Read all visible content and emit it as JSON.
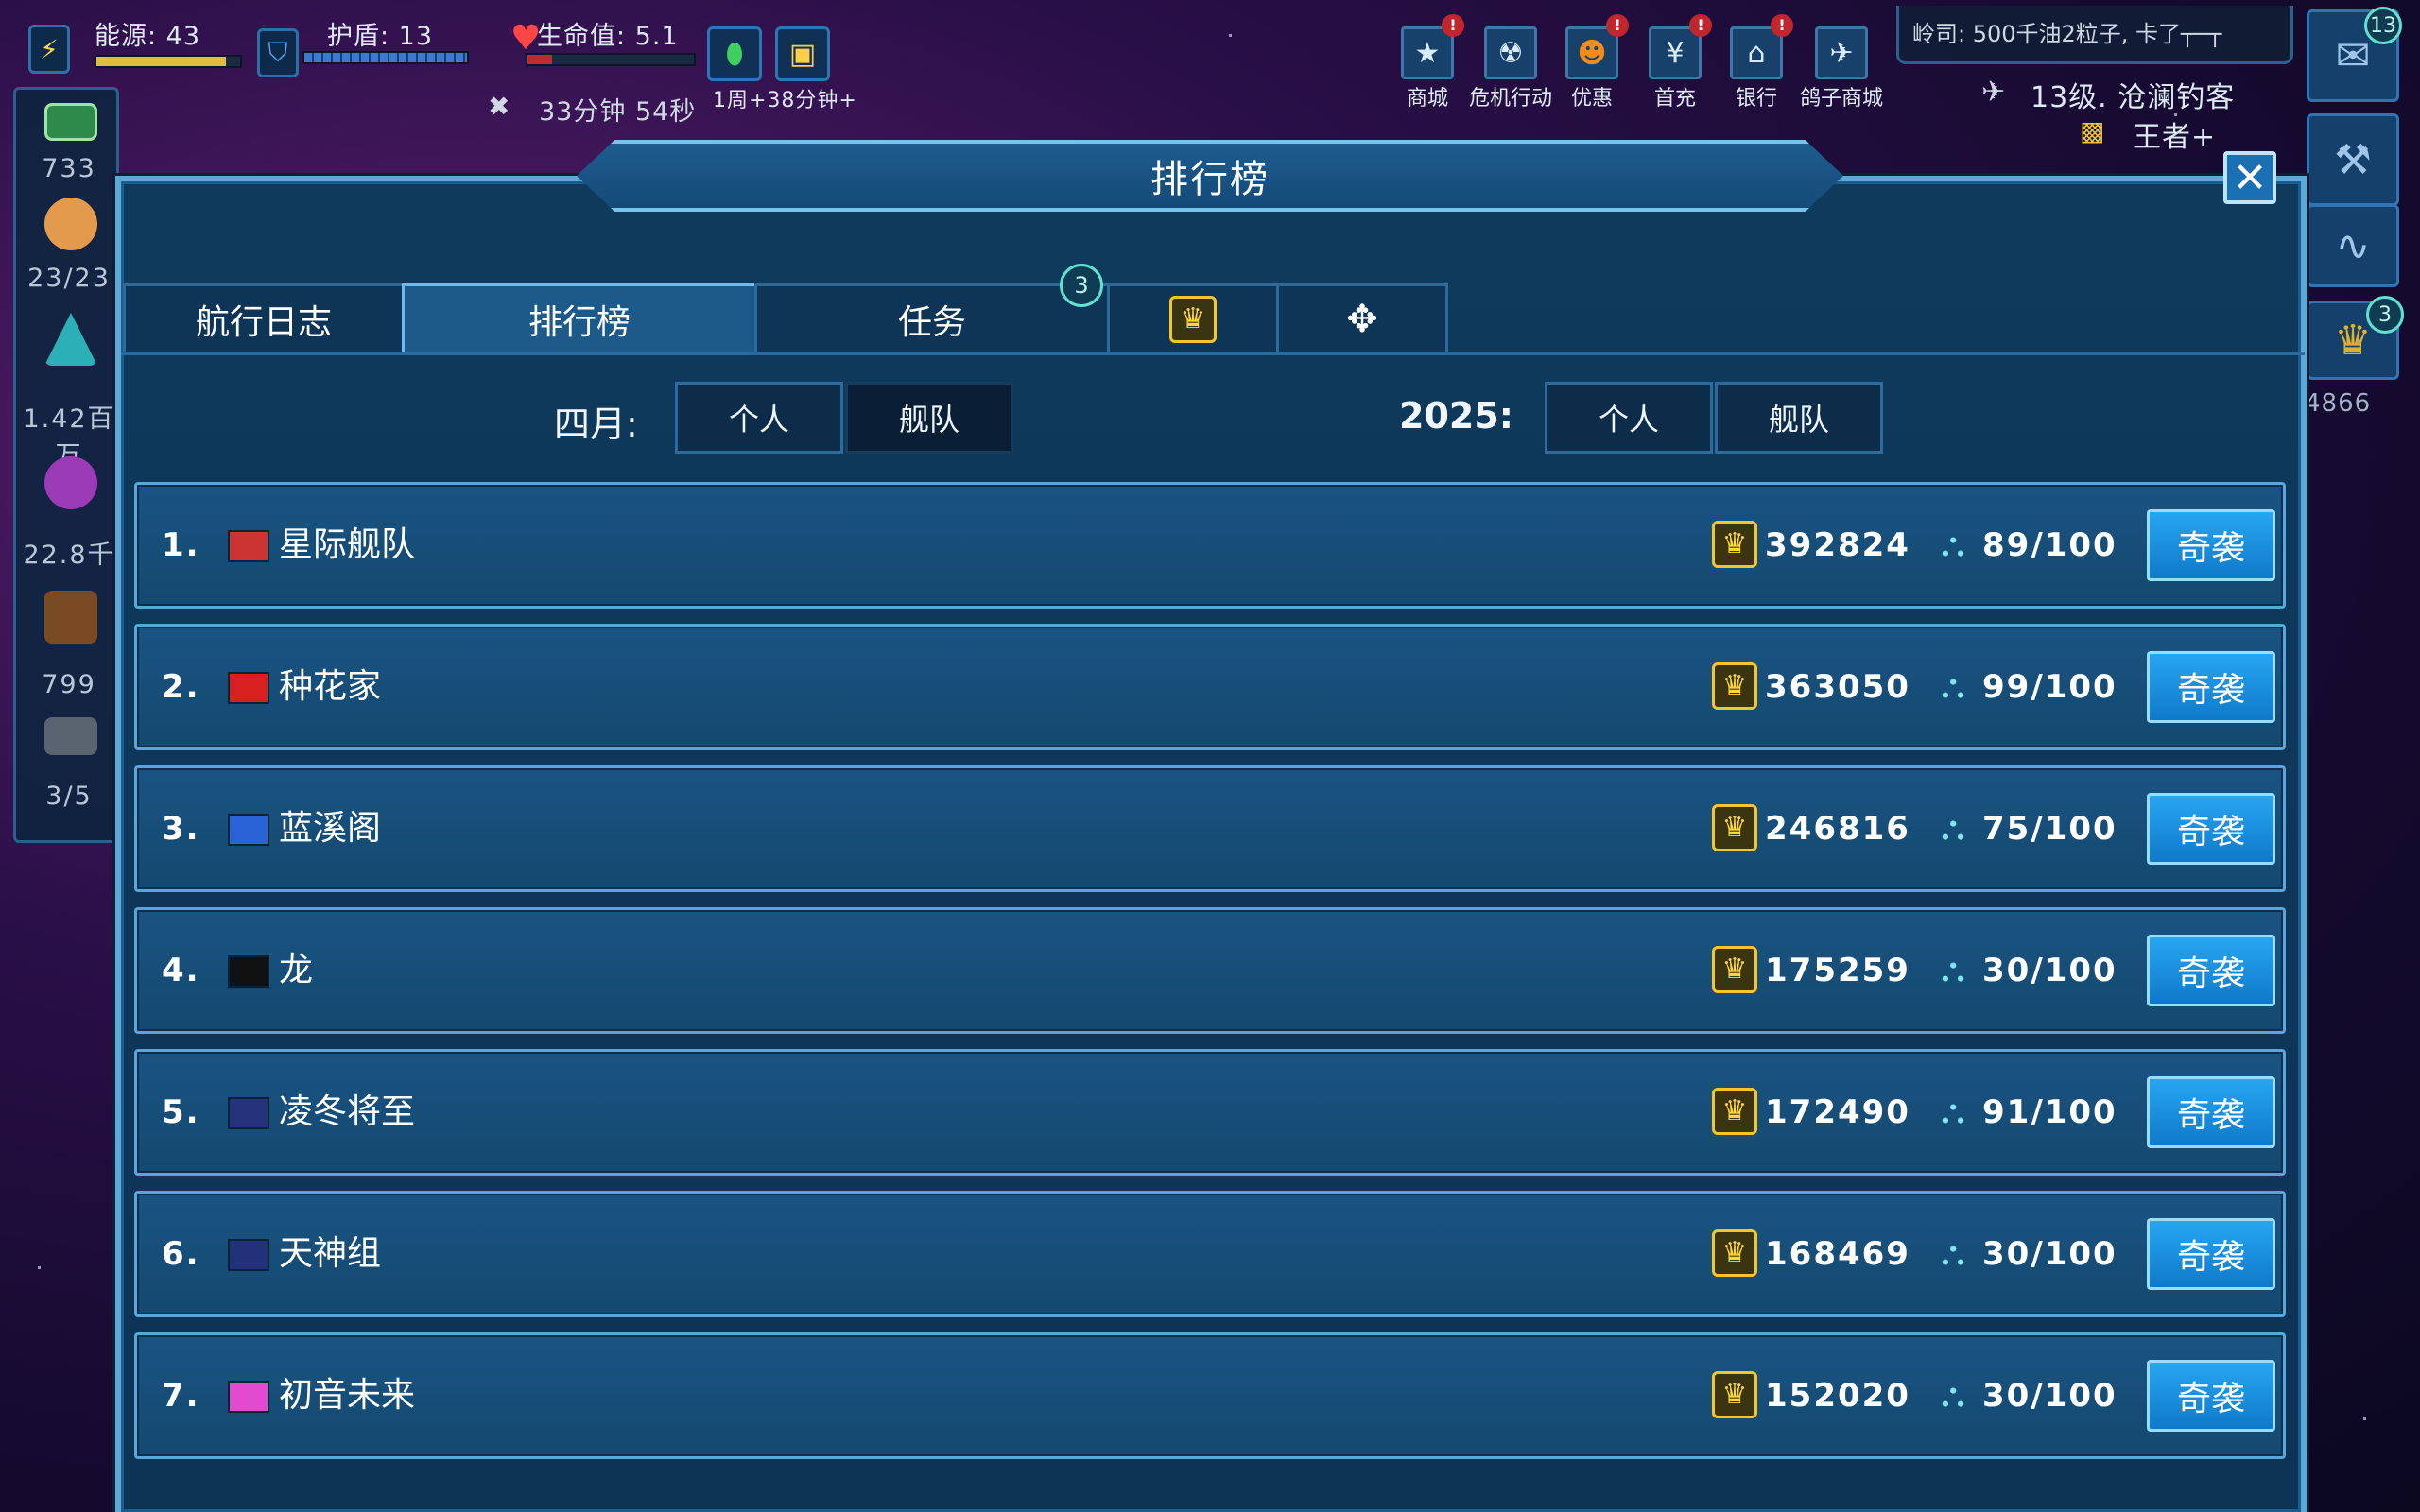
{
  "hud": {
    "energy": "能源: 43",
    "shield": "护盾: 13",
    "health": "生命值: 5.1",
    "timer": "33分钟 54秒",
    "timer_bonus": "1周+38分钟+",
    "chat_preview": "岭司: 500千油2粒子, 卡了┬─┬",
    "player_level": "13级. 沧澜钓客",
    "player_rank": "王者+",
    "energy_fill": 0.9,
    "shield_fill": 1.0,
    "health_fill": 0.15
  },
  "top_menu": [
    {
      "label": "商城",
      "icon": "star-icon",
      "alert": "!"
    },
    {
      "label": "危机行动",
      "icon": "radiation-icon",
      "alert": ""
    },
    {
      "label": "优惠",
      "icon": "pumpkin-icon",
      "alert": "!"
    },
    {
      "label": "首充",
      "icon": "yen-icon",
      "alert": "!"
    },
    {
      "label": "银行",
      "icon": "bank-icon",
      "alert": "!"
    },
    {
      "label": "鸽子商城",
      "icon": "pigeon-icon",
      "alert": ""
    }
  ],
  "left_panel": {
    "cash": "733",
    "crew": "23/23",
    "crystal": "1.42百万",
    "planet": "22.8千",
    "cargo": "799",
    "drones": "3/5"
  },
  "right_panel": {
    "chat_badge": "13",
    "trophy_badge": "3",
    "trophy_count": "4866"
  },
  "panel": {
    "title": "排行榜",
    "close_label": "✕"
  },
  "tabs": [
    {
      "label": "航行日志",
      "active": false
    },
    {
      "label": "排行榜",
      "active": true
    },
    {
      "label": "任务",
      "active": false,
      "badge": "3"
    },
    {
      "label": "trophy",
      "active": false
    },
    {
      "label": "arrows",
      "active": false
    }
  ],
  "filters": {
    "month_label": "四月:",
    "year_label": "2025:",
    "individual": "个人",
    "fleet": "舰队"
  },
  "rows": [
    {
      "rank": "1.",
      "name": "星际舰队",
      "score": "392824",
      "members": "89/100",
      "action": "奇袭",
      "flag": "#c33"
    },
    {
      "rank": "2.",
      "name": "种花家",
      "score": "363050",
      "members": "99/100",
      "action": "奇袭",
      "flag": "#d82020"
    },
    {
      "rank": "3.",
      "name": "蓝溪阁",
      "score": "246816",
      "members": "75/100",
      "action": "奇袭",
      "flag": "#2a62d8"
    },
    {
      "rank": "4.",
      "name": "龙",
      "score": "175259",
      "members": "30/100",
      "action": "奇袭",
      "flag": "#111"
    },
    {
      "rank": "5.",
      "name": "凌冬将至",
      "score": "172490",
      "members": "91/100",
      "action": "奇袭",
      "flag": "#26327a"
    },
    {
      "rank": "6.",
      "name": "天神组",
      "score": "168469",
      "members": "30/100",
      "action": "奇袭",
      "flag": "#23307a"
    },
    {
      "rank": "7.",
      "name": "初音未来",
      "score": "152020",
      "members": "30/100",
      "action": "奇袭",
      "flag": "#e24ad0"
    }
  ]
}
